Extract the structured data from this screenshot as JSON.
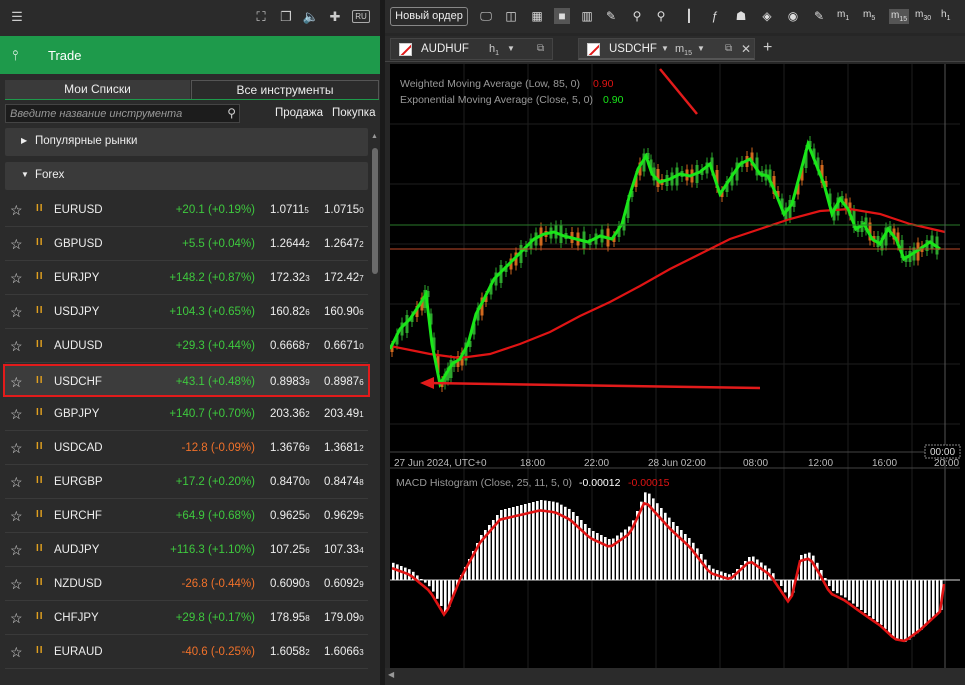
{
  "left_panel": {
    "ru_label": "RU",
    "trade_label": "Trade",
    "tabs": [
      "Мои Списки",
      "Все инструменты"
    ],
    "search_placeholder": "Введите название инструмента",
    "col_sell": "Продажа",
    "col_buy": "Покупка",
    "groups": [
      "Популярные рынки",
      "Forex"
    ],
    "rows": [
      {
        "sym": "EURUSD",
        "chg": "+20.1 (+0.19%)",
        "dir": "pos",
        "bid": "1.0711",
        "bid_s": "5",
        "ask": "1.0715",
        "ask_s": "0"
      },
      {
        "sym": "GBPUSD",
        "chg": "+5.5 (+0.04%)",
        "dir": "pos",
        "bid": "1.2644",
        "bid_s": "2",
        "ask": "1.2647",
        "ask_s": "2"
      },
      {
        "sym": "EURJPY",
        "chg": "+148.2 (+0.87%)",
        "dir": "pos",
        "bid": "172.32",
        "bid_s": "3",
        "ask": "172.42",
        "ask_s": "7"
      },
      {
        "sym": "USDJPY",
        "chg": "+104.3 (+0.65%)",
        "dir": "pos",
        "bid": "160.82",
        "bid_s": "6",
        "ask": "160.90",
        "ask_s": "6"
      },
      {
        "sym": "AUDUSD",
        "chg": "+29.3 (+0.44%)",
        "dir": "pos",
        "bid": "0.6668",
        "bid_s": "7",
        "ask": "0.6671",
        "ask_s": "0"
      },
      {
        "sym": "USDCHF",
        "chg": "+43.1 (+0.48%)",
        "dir": "pos",
        "bid": "0.8983",
        "bid_s": "9",
        "ask": "0.8987",
        "ask_s": "6",
        "selected": true
      },
      {
        "sym": "GBPJPY",
        "chg": "+140.7 (+0.70%)",
        "dir": "pos",
        "bid": "203.36",
        "bid_s": "2",
        "ask": "203.49",
        "ask_s": "1"
      },
      {
        "sym": "USDCAD",
        "chg": "-12.8 (-0.09%)",
        "dir": "neg",
        "bid": "1.3676",
        "bid_s": "9",
        "ask": "1.3681",
        "ask_s": "2"
      },
      {
        "sym": "EURGBP",
        "chg": "+17.2 (+0.20%)",
        "dir": "pos",
        "bid": "0.8470",
        "bid_s": "0",
        "ask": "0.8474",
        "ask_s": "8"
      },
      {
        "sym": "EURCHF",
        "chg": "+64.9 (+0.68%)",
        "dir": "pos",
        "bid": "0.9625",
        "bid_s": "0",
        "ask": "0.9629",
        "ask_s": "5"
      },
      {
        "sym": "AUDJPY",
        "chg": "+116.3 (+1.10%)",
        "dir": "pos",
        "bid": "107.25",
        "bid_s": "6",
        "ask": "107.33",
        "ask_s": "4"
      },
      {
        "sym": "NZDUSD",
        "chg": "-26.8 (-0.44%)",
        "dir": "neg",
        "bid": "0.6090",
        "bid_s": "3",
        "ask": "0.6092",
        "ask_s": "9"
      },
      {
        "sym": "CHFJPY",
        "chg": "+29.8 (+0.17%)",
        "dir": "pos",
        "bid": "178.95",
        "bid_s": "8",
        "ask": "179.09",
        "ask_s": "0"
      },
      {
        "sym": "EURAUD",
        "chg": "-40.6 (-0.25%)",
        "dir": "neg",
        "bid": "1.6058",
        "bid_s": "2",
        "ask": "1.6066",
        "ask_s": "3"
      }
    ]
  },
  "toolbar": {
    "new_order": "Новый ордер",
    "timeframes": [
      {
        "l": "m",
        "s": "1"
      },
      {
        "l": "m",
        "s": "5"
      },
      {
        "l": "m",
        "s": "15"
      },
      {
        "l": "m",
        "s": "30"
      },
      {
        "l": "h",
        "s": "1"
      }
    ]
  },
  "chart_tabs": [
    {
      "name": "AUDHUF",
      "tf": "h",
      "tf_sub": "1"
    },
    {
      "name": "USDCHF",
      "tf": "m",
      "tf_sub": "15"
    }
  ],
  "indicators": {
    "wma_label": "Weighted Moving Average (Low, 85, 0)",
    "wma_value": "0.90",
    "ema_label": "Exponential Moving Average (Close, 5, 0)",
    "ema_value": "0.90",
    "macd_label": "MACD Histogram (Close, 25, 11, 5, 0)",
    "macd_v1": "-0.00012",
    "macd_v2": "-0.00015"
  },
  "time_axis": [
    "27 Jun 2024, UTC+0",
    "18:00",
    "22:00",
    "28 Jun 02:00",
    "08:00",
    "12:00",
    "16:00",
    "20:00"
  ],
  "time_badge": "00:00",
  "colors": {
    "accent": "#1e9a4b",
    "positive": "#3ec93e",
    "negative": "#f0712a",
    "highlight": "#e21b1b",
    "ema": "#19e619",
    "wma": "#e01414"
  }
}
